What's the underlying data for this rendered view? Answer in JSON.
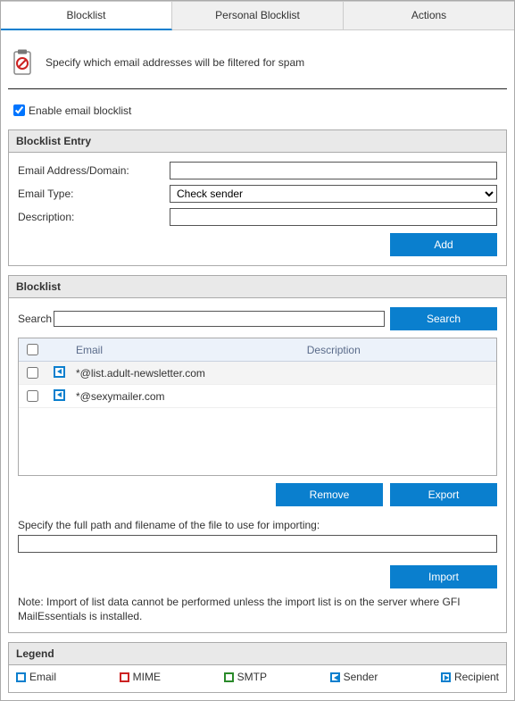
{
  "tabs": {
    "blocklist": "Blocklist",
    "personal": "Personal Blocklist",
    "actions": "Actions"
  },
  "info_text": "Specify which email addresses will be filtered for spam",
  "enable_label": "Enable email blocklist",
  "entry": {
    "title": "Blocklist Entry",
    "email_label": "Email Address/Domain:",
    "type_label": "Email Type:",
    "desc_label": "Description:",
    "type_selected": "Check sender",
    "add_button": "Add"
  },
  "blocklist": {
    "title": "Blocklist",
    "search_label": "Search",
    "search_button": "Search",
    "columns": {
      "email": "Email",
      "description": "Description"
    },
    "rows": [
      {
        "email": "*@list.adult-newsletter.com",
        "description": ""
      },
      {
        "email": "*@sexymailer.com",
        "description": ""
      }
    ],
    "remove_button": "Remove",
    "export_button": "Export",
    "import_intro": "Specify the full path and filename of the file to use for importing:",
    "import_button": "Import",
    "note": "Note: Import of list data cannot be performed unless the import list is on the server where GFI MailEssentials is installed."
  },
  "legend": {
    "title": "Legend",
    "email": "Email",
    "mime": "MIME",
    "smtp": "SMTP",
    "sender": "Sender",
    "recipient": "Recipient"
  }
}
